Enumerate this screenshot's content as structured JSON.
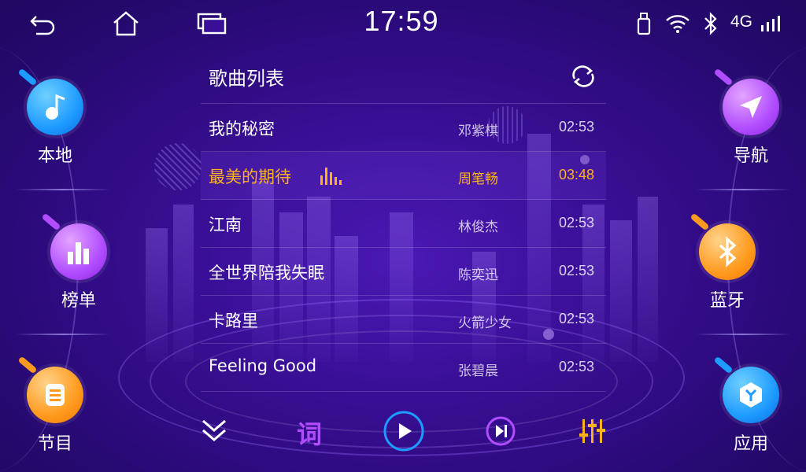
{
  "status_bar": {
    "time": "17:59",
    "network": "4G",
    "icons": [
      "back-icon",
      "home-icon",
      "recent-apps-icon",
      "usb-icon",
      "wifi-icon",
      "bluetooth-icon",
      "signal-icon"
    ]
  },
  "left_apps": [
    {
      "label": "本地",
      "icon": "music-note-icon",
      "color": "#1e9bff"
    },
    {
      "label": "榜单",
      "icon": "chart-icon",
      "color": "#b24dff"
    },
    {
      "label": "节目",
      "icon": "program-icon",
      "color": "#ff9a1e"
    }
  ],
  "right_apps": [
    {
      "label": "导航",
      "icon": "navigation-icon",
      "color": "#b24dff"
    },
    {
      "label": "蓝牙",
      "icon": "bluetooth-icon",
      "color": "#ff9a1e"
    },
    {
      "label": "应用",
      "icon": "cube-icon",
      "color": "#1e9bff"
    }
  ],
  "playlist": {
    "title": "歌曲列表",
    "songs": [
      {
        "title": "我的秘密",
        "artist": "邓紫棋",
        "duration": "02:53",
        "active": false
      },
      {
        "title": "最美的期待",
        "artist": "周笔畅",
        "duration": "03:48",
        "active": true
      },
      {
        "title": "江南",
        "artist": "林俊杰",
        "duration": "02:53",
        "active": false
      },
      {
        "title": "全世界陪我失眠",
        "artist": "陈奕迅",
        "duration": "02:53",
        "active": false
      },
      {
        "title": "卡路里",
        "artist": "火箭少女",
        "duration": "02:53",
        "active": false
      },
      {
        "title": "Feeling Good",
        "artist": "张碧晨",
        "duration": "02:53",
        "active": false
      }
    ]
  },
  "controls": {
    "lyrics_label": "词",
    "accent_active": "#ffb21d",
    "accent_purple": "#b24dff",
    "accent_blue": "#1e9bff"
  }
}
